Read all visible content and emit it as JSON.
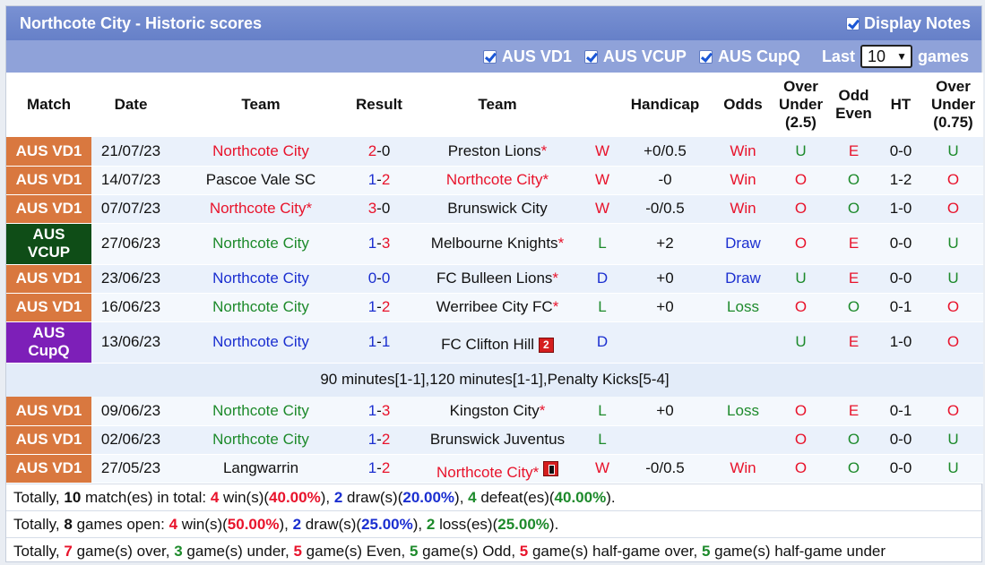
{
  "header": {
    "title": "Northcote City - Historic scores",
    "display_notes": "Display Notes"
  },
  "filters": {
    "f1": "AUS VD1",
    "f2": "AUS VCUP",
    "f3": "AUS CupQ",
    "last": "Last",
    "count": "10",
    "games": "games"
  },
  "columns": {
    "match": "Match",
    "date": "Date",
    "team1": "Team",
    "result": "Result",
    "team2": "Team",
    "handicap": "Handicap",
    "odds": "Odds",
    "ou25_a": "Over",
    "ou25_b": "Under",
    "ou25_c": "(2.5)",
    "oe_a": "Odd",
    "oe_b": "Even",
    "ht": "HT",
    "ou075_a": "Over",
    "ou075_b": "Under",
    "ou075_c": "(0.75)"
  },
  "rows": [
    {
      "comp": "AUS VD1",
      "date": "21/07/23",
      "home": "Northcote City",
      "hs": "2",
      "as": "0",
      "away": "Preston Lions",
      "away_star": "*",
      "wl": "W",
      "hcap": "+0/0.5",
      "odds": "Win",
      "ou": "U",
      "oe": "E",
      "ht": "0-0",
      "ou2": "U"
    },
    {
      "comp": "AUS VD1",
      "date": "14/07/23",
      "home": "Pascoe Vale SC",
      "hs": "1",
      "as": "2",
      "away": "Northcote City",
      "away_star": "*",
      "wl": "W",
      "hcap": "-0",
      "odds": "Win",
      "ou": "O",
      "oe": "O",
      "ht": "1-2",
      "ou2": "O"
    },
    {
      "comp": "AUS VD1",
      "date": "07/07/23",
      "home": "Northcote City",
      "home_star": "*",
      "hs": "3",
      "as": "0",
      "away": "Brunswick City",
      "wl": "W",
      "hcap": "-0/0.5",
      "odds": "Win",
      "ou": "O",
      "oe": "O",
      "ht": "1-0",
      "ou2": "O"
    },
    {
      "comp1": "AUS",
      "comp2": "VCUP",
      "date": "27/06/23",
      "home": "Northcote City",
      "hs": "1",
      "as": "3",
      "away": "Melbourne Knights",
      "away_star": "*",
      "wl": "L",
      "hcap": "+2",
      "odds": "Draw",
      "ou": "O",
      "oe": "E",
      "ht": "0-0",
      "ou2": "U"
    },
    {
      "comp": "AUS VD1",
      "date": "23/06/23",
      "home": "Northcote City",
      "hs": "0",
      "as": "0",
      "away": "FC Bulleen Lions",
      "away_star": "*",
      "wl": "D",
      "hcap": "+0",
      "odds": "Draw",
      "ou": "U",
      "oe": "E",
      "ht": "0-0",
      "ou2": "U"
    },
    {
      "comp": "AUS VD1",
      "date": "16/06/23",
      "home": "Northcote City",
      "hs": "1",
      "as": "2",
      "away": "Werribee City FC",
      "away_star": "*",
      "wl": "L",
      "hcap": "+0",
      "odds": "Loss",
      "ou": "O",
      "oe": "O",
      "ht": "0-1",
      "ou2": "O"
    },
    {
      "comp1": "AUS",
      "comp2": "CupQ",
      "date": "13/06/23",
      "home": "Northcote City",
      "hs": "1",
      "as": "1",
      "away": "FC Clifton Hill",
      "badge": "2",
      "wl": "D",
      "hcap": "",
      "odds": "",
      "ou": "U",
      "oe": "E",
      "ht": "1-0",
      "ou2": "O"
    },
    {
      "comp": "AUS VD1",
      "date": "09/06/23",
      "home": "Northcote City",
      "hs": "1",
      "as": "3",
      "away": "Kingston City",
      "away_star": "*",
      "wl": "L",
      "hcap": "+0",
      "odds": "Loss",
      "ou": "O",
      "oe": "E",
      "ht": "0-1",
      "ou2": "O"
    },
    {
      "comp": "AUS VD1",
      "date": "02/06/23",
      "home": "Northcote City",
      "hs": "1",
      "as": "2",
      "away": "Brunswick Juventus",
      "wl": "L",
      "hcap": "",
      "odds": "",
      "ou": "O",
      "oe": "O",
      "ht": "0-0",
      "ou2": "U"
    },
    {
      "comp": "AUS VD1",
      "date": "27/05/23",
      "home": "Langwarrin",
      "hs": "1",
      "as": "2",
      "away": "Northcote City",
      "away_star": "*",
      "wl": "W",
      "hcap": "-0/0.5",
      "odds": "Win",
      "ou": "O",
      "oe": "O",
      "ht": "0-0",
      "ou2": "U"
    }
  ],
  "note": "90 minutes[1-1],120 minutes[1-1],Penalty Kicks[5-4]",
  "summary": {
    "s1": {
      "a": "Totally, ",
      "n1": "10",
      "b": " match(es) in total: ",
      "w": "4",
      "c": " win(s)(",
      "wp": "40.00%",
      "d": "), ",
      "dr": "2",
      "e": " draw(s)(",
      "dp": "20.00%",
      "f": "), ",
      "l": "4",
      "g": " defeat(es)(",
      "lp": "40.00%",
      "h": ")."
    },
    "s2": {
      "a": "Totally, ",
      "n1": "8",
      "b": " games open: ",
      "w": "4",
      "c": " win(s)(",
      "wp": "50.00%",
      "d": "), ",
      "dr": "2",
      "e": " draw(s)(",
      "dp": "25.00%",
      "f": "), ",
      "l": "2",
      "g": " loss(es)(",
      "lp": "25.00%",
      "h": ")."
    },
    "s3": {
      "a": "Totally, ",
      "o": "7",
      "b": " game(s) over, ",
      "u": "3",
      "c": " game(s) under, ",
      "ev": "5",
      "d": " game(s) Even, ",
      "od": "5",
      "e": " game(s) Odd, ",
      "ho": "5",
      "f": " game(s) half-game over, ",
      "hu": "5",
      "g": " game(s) half-game under"
    }
  },
  "colors": {
    "header": "#6c86cc",
    "filterbar": "#8fa2d9",
    "vd1": "#d9783f",
    "vcup": "#0f4d17",
    "cupq": "#7d1fb8",
    "win": "#e8132b",
    "draw": "#1b2fd0",
    "loss": "#1d8a2b"
  }
}
